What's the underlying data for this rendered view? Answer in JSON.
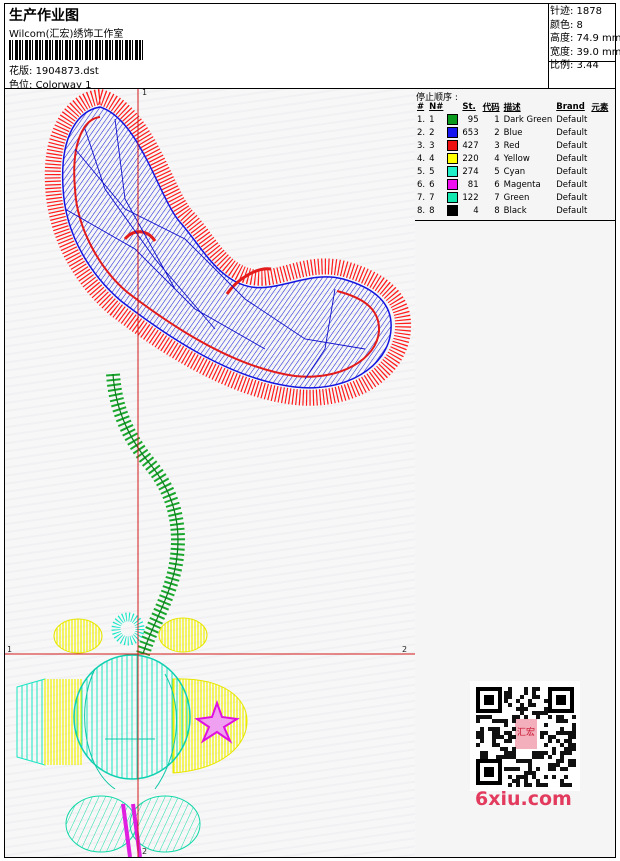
{
  "header": {
    "title": "生产作业图",
    "subtitle": "Wilcom(汇宏)绣饰工作室",
    "design_label": "花版:",
    "design_value": "1904873.dst",
    "colorway_label": "色位:",
    "colorway_value": "Colorway 1"
  },
  "stats": {
    "stitches": "针迹: 1878",
    "colors": "颜色: 8",
    "height": "高度: 74.9 mm",
    "width": "宽度: 39.0 mm",
    "ratio": "比例: 3.44"
  },
  "stop_sequence": {
    "title": "停止顺序 :",
    "headers": [
      "#",
      "N#",
      "St.",
      "代码",
      "描述",
      "Brand",
      "元素"
    ],
    "rows": [
      {
        "idx": "1.",
        "n": "1",
        "color": "#0a9a1e",
        "st": "95",
        "code": "1",
        "desc": "Dark Green",
        "brand": "Default"
      },
      {
        "idx": "2.",
        "n": "2",
        "color": "#1616f0",
        "st": "653",
        "code": "2",
        "desc": "Blue",
        "brand": "Default"
      },
      {
        "idx": "3.",
        "n": "3",
        "color": "#ee1010",
        "st": "427",
        "code": "3",
        "desc": "Red",
        "brand": "Default"
      },
      {
        "idx": "4.",
        "n": "4",
        "color": "#ffff00",
        "st": "220",
        "code": "4",
        "desc": "Yellow",
        "brand": "Default"
      },
      {
        "idx": "5.",
        "n": "5",
        "color": "#20f0c8",
        "st": "274",
        "code": "5",
        "desc": "Cyan",
        "brand": "Default"
      },
      {
        "idx": "6.",
        "n": "6",
        "color": "#f010f0",
        "st": "81",
        "code": "6",
        "desc": "Magenta",
        "brand": "Default"
      },
      {
        "idx": "7.",
        "n": "7",
        "color": "#10e8b0",
        "st": "122",
        "code": "7",
        "desc": "Green",
        "brand": "Default"
      },
      {
        "idx": "8.",
        "n": "8",
        "color": "#000000",
        "st": "4",
        "code": "8",
        "desc": "Black",
        "brand": "Default"
      }
    ]
  },
  "axes": {
    "top_label": "1",
    "left_label": "1",
    "right_label": "2",
    "bottom_label": "2"
  },
  "watermark": {
    "text": "6xiu.com",
    "seal_text": "汇宏"
  }
}
